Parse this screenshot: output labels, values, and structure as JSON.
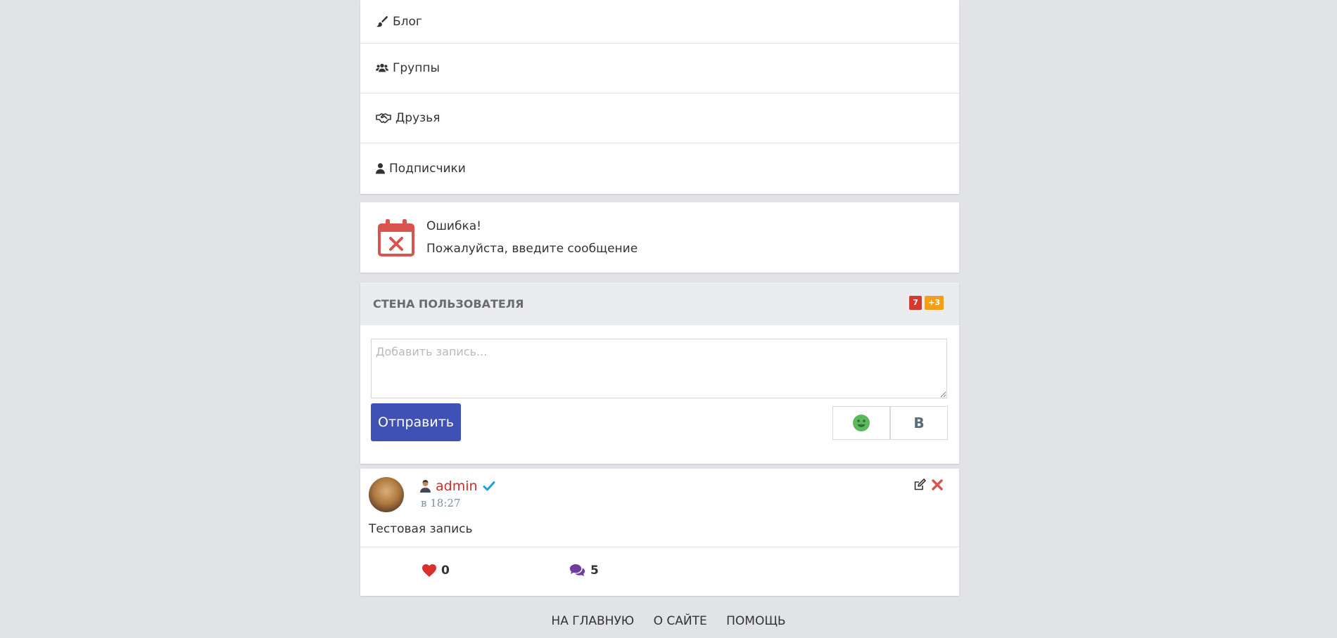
{
  "menu": {
    "items": [
      {
        "label": "Блог",
        "icon": "brush-icon"
      },
      {
        "label": "Группы",
        "icon": "users-icon"
      },
      {
        "label": "Друзья",
        "icon": "handshake-icon"
      },
      {
        "label": "Подписчики",
        "icon": "user-icon"
      }
    ]
  },
  "error": {
    "title": "Ошибка!",
    "message": "Пожалуйста, введите сообщение",
    "icon": "calendar-x-icon",
    "color": "#d9534f"
  },
  "wall": {
    "title": "СТЕНА ПОЛЬЗОВАТЕЛЯ",
    "badge_count": "7",
    "badge_new": "+3",
    "input_placeholder": "Добавить запись...",
    "send_label": "Отправить",
    "smile_icon": "smile-icon",
    "bold_label": "B",
    "accent": "#3f51b5"
  },
  "post": {
    "author": "admin",
    "time": "в 18:27",
    "text": "Тестовая запись",
    "likes": "0",
    "comments": "5"
  },
  "footer": {
    "links": [
      "НА ГЛАВНУЮ",
      "О САЙТЕ",
      "ПОМОЩЬ"
    ]
  }
}
